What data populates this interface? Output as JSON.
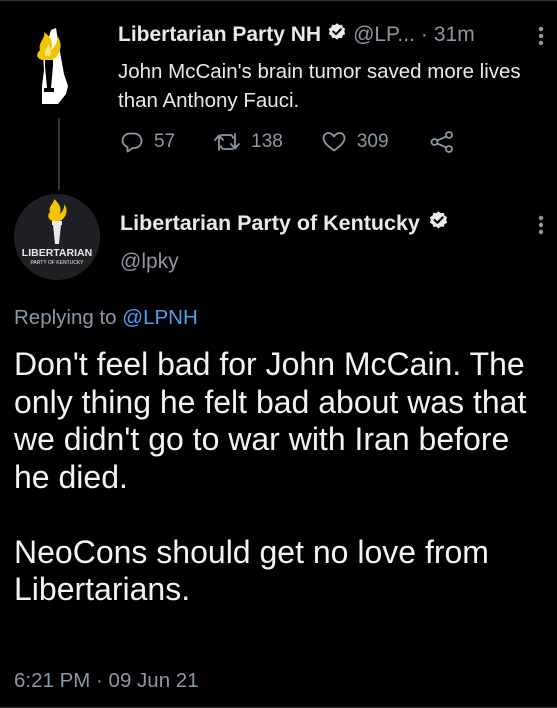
{
  "parent_tweet": {
    "author_name": "Libertarian Party NH",
    "handle": "@LP...",
    "separator": "·",
    "time": "31m",
    "text": "John McCain's brain tumor saved more lives than Anthony Fauci.",
    "replies": "57",
    "retweets": "138",
    "likes": "309"
  },
  "reply_tweet": {
    "author_name": "Libertarian Party of Kentucky",
    "handle": "@lpky",
    "avatar_text": "LIBERTARIAN",
    "avatar_subtext": "PARTY OF KENTUCKY",
    "replying_prefix": "Replying to",
    "replying_handle": "@LPNH",
    "text": "Don't feel bad for John McCain. The only thing he felt bad about was that we didn't go to war with Iran before he died.\n\nNeoCons should get no love from Libertarians.",
    "timestamp": "6:21 PM · 09 Jun 21"
  },
  "colors": {
    "background": "#000000",
    "text": "#e7e9ea",
    "secondary": "#8b98a5",
    "link": "#4d9ff0",
    "torch_flame": "#f5c400"
  },
  "icons": [
    "verified-badge-icon",
    "more-icon",
    "reply-icon",
    "retweet-icon",
    "like-icon",
    "share-icon",
    "nh-torch-logo",
    "ky-torch-logo"
  ]
}
